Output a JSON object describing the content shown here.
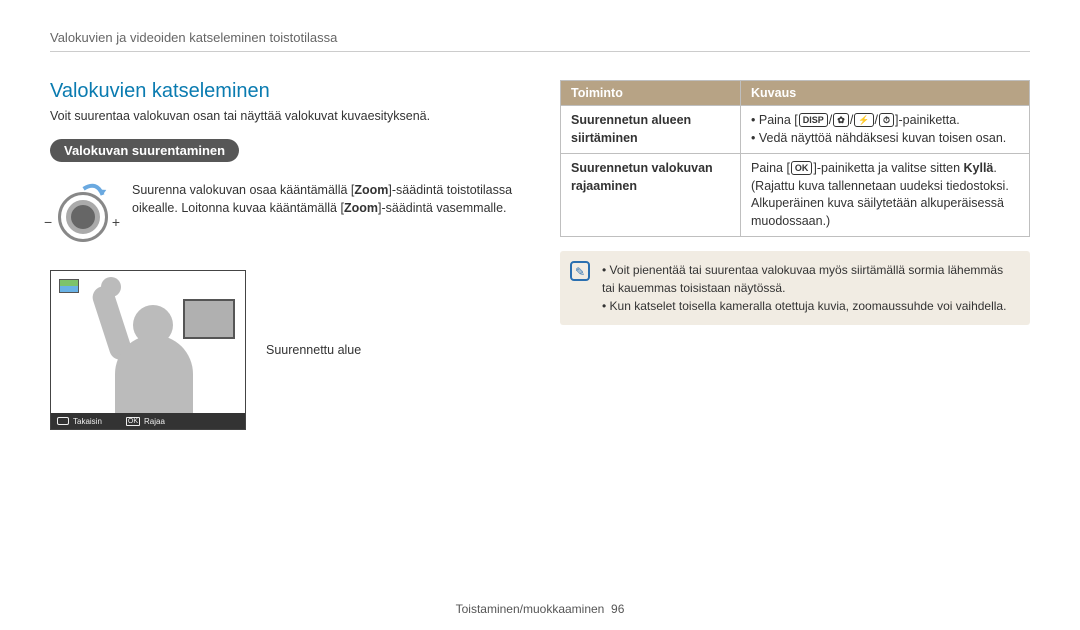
{
  "breadcrumb": "Valokuvien ja videoiden katseleminen toistotilassa",
  "title": "Valokuvien katseleminen",
  "intro": "Voit suurentaa valokuvan osan tai näyttää valokuvat kuvaesityksenä.",
  "section_pill": "Valokuvan suurentaminen",
  "zoom_text": {
    "part1": "Suurenna valokuvan osaa kääntämällä [",
    "zoom1": "Zoom",
    "part2": "]-säädintä toistotilassa oikealle. Loitonna kuvaa kääntämällä [",
    "zoom2": "Zoom",
    "part3": "]-säädintä vasemmalle."
  },
  "preview_caption": "Suurennettu alue",
  "preview_footer": {
    "back": "Takaisin",
    "crop": "Rajaa",
    "ok": "OK"
  },
  "table": {
    "header_function": "Toiminto",
    "header_desc": "Kuvaus",
    "rows": [
      {
        "label": "Suurennetun alueen siirtäminen",
        "desc_items": [
          {
            "pre": "Paina [",
            "glyphs": [
              "DISP",
              "✿",
              "⚡",
              "⏱"
            ],
            "post": "]-painiketta."
          },
          {
            "text": "Vedä näyttöä nähdäksesi kuvan toisen osan."
          }
        ]
      },
      {
        "label": "Suurennetun valokuvan rajaaminen",
        "desc_text": {
          "pre": "Paina [",
          "glyphs": [
            "OK"
          ],
          "mid": "]-painiketta ja valitse sitten ",
          "bold": "Kyllä",
          "post": ". (Rajattu kuva tallennetaan uudeksi tiedostoksi. Alkuperäinen kuva säilytetään alkuperäisessä muodossaan.)"
        }
      }
    ]
  },
  "note": {
    "items": [
      "Voit pienentää tai suurentaa valokuvaa myös siirtämällä sormia lähemmäs tai kauemmas toisistaan näytössä.",
      "Kun katselet toisella kameralla otettuja kuvia, zoomaussuhde voi vaihdella."
    ]
  },
  "footer": {
    "section": "Toistaminen/muokkaaminen",
    "page": "96"
  }
}
